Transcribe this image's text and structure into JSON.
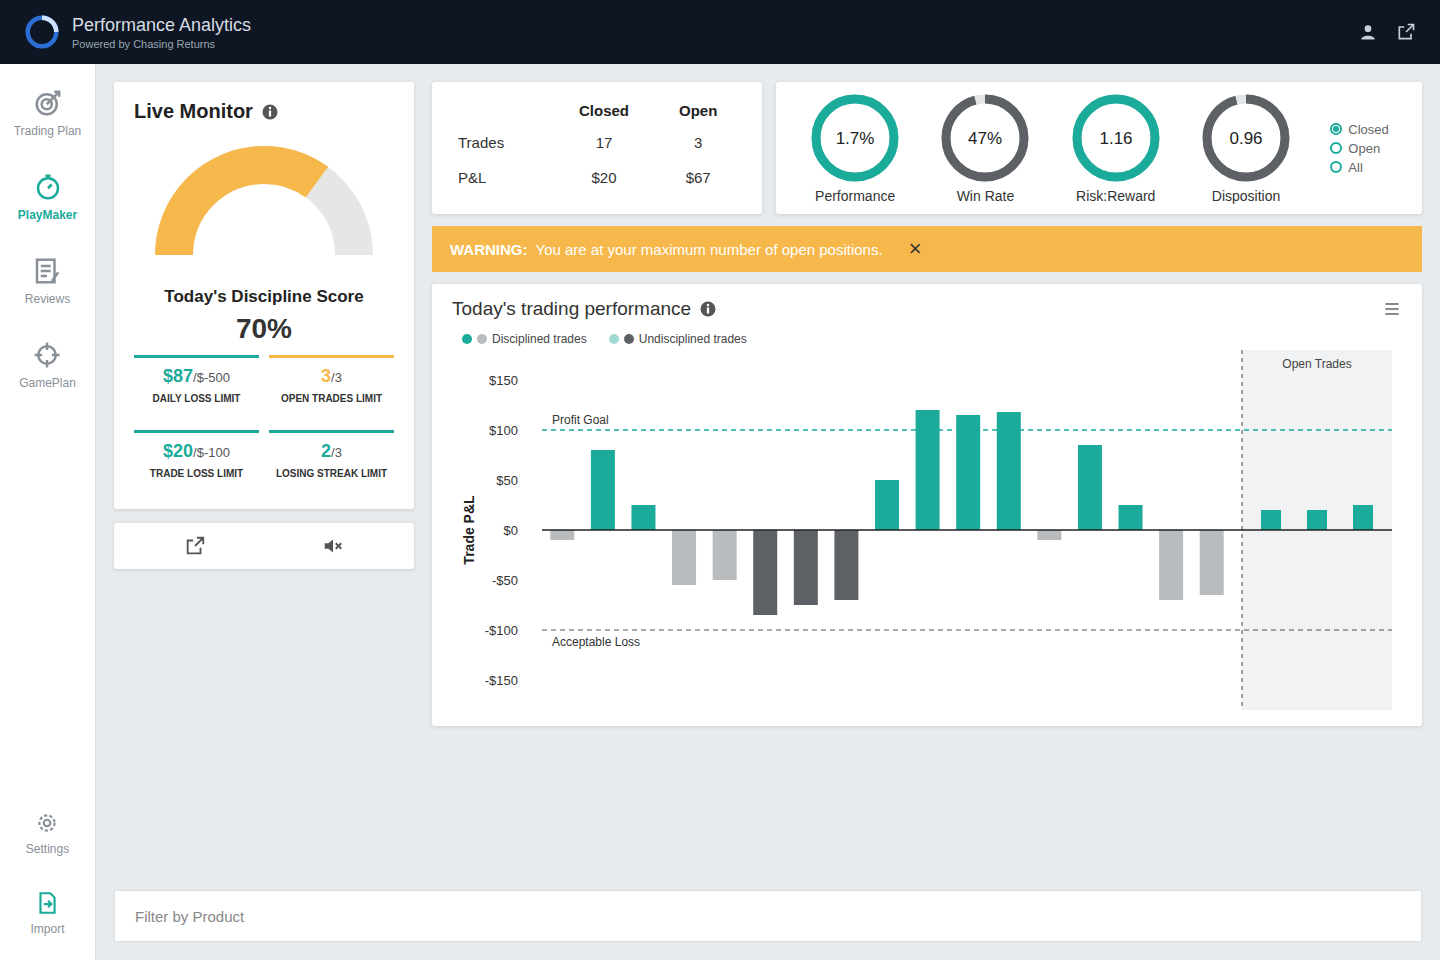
{
  "app": {
    "title": "Performance Analytics",
    "subtitle": "Powered by Chasing Returns"
  },
  "sidebar": {
    "items": [
      {
        "label": "Trading Plan",
        "selected": false
      },
      {
        "label": "PlayMaker",
        "selected": true
      },
      {
        "label": "Reviews",
        "selected": false
      },
      {
        "label": "GamePlan",
        "selected": false
      },
      {
        "label": "Settings",
        "selected": false
      },
      {
        "label": "Import",
        "selected": false
      }
    ]
  },
  "live_monitor": {
    "title": "Live Monitor",
    "score_label": "Today's Discipline Score",
    "score": "70%",
    "level": 0.7,
    "limits": [
      {
        "value": "$87",
        "limit": "/$-500",
        "label": "DAILY LOSS LIMIT",
        "color": "#1aab9b"
      },
      {
        "value": "3",
        "limit": "/3",
        "label": "OPEN TRADES LIMIT",
        "color": "#f7b84b"
      },
      {
        "value": "$20",
        "limit": "/$-100",
        "label": "TRADE LOSS LIMIT",
        "color": "#1aab9b"
      },
      {
        "value": "2",
        "limit": "/3",
        "label": "LOSING STREAK LIMIT",
        "color": "#1aab9b"
      }
    ]
  },
  "summary": {
    "columns": [
      "Closed",
      "Open"
    ],
    "rows": [
      {
        "label": "Trades",
        "cells": [
          "17",
          "3"
        ]
      },
      {
        "label": "P&L",
        "cells": [
          "$20",
          "$67"
        ]
      }
    ]
  },
  "gauges": [
    {
      "value": "1.7%",
      "label": "Performance",
      "level": 1,
      "color": "#1aab9b"
    },
    {
      "value": "47%",
      "label": "Win Rate",
      "level": 0.96,
      "color": "#5d6166"
    },
    {
      "value": "1.16",
      "label": "Risk:Reward",
      "level": 1,
      "color": "#1aab9b"
    },
    {
      "value": "0.96",
      "label": "Disposition",
      "level": 0.96,
      "color": "#5d6166"
    }
  ],
  "view_filter": {
    "options": [
      {
        "label": "Closed",
        "selected": true
      },
      {
        "label": "Open",
        "selected": false
      },
      {
        "label": "All",
        "selected": false
      }
    ]
  },
  "warning": {
    "label": "WARNING:",
    "text": "You are at your maximum number of open positions.",
    "close": "×"
  },
  "chart": {
    "title": "Today's trading performance",
    "axis_label": "Trade P&L",
    "ticks": [
      "$150",
      "$100",
      "$50",
      "$0",
      "-$50",
      "-$100",
      "-$150"
    ],
    "tick_values": [
      150,
      100,
      50,
      0,
      -50,
      -100,
      -150
    ],
    "legend": [
      {
        "label": "Disciplined trades",
        "colors": [
          "#1aab9b",
          "#b9bcbf"
        ]
      },
      {
        "label": "Undisciplined trades",
        "colors": [
          "#9fd9d2",
          "#5d6166"
        ]
      }
    ],
    "profit_goal": {
      "label": "Profit Goal",
      "value": 100
    },
    "acceptable_loss": {
      "label": "Acceptable Loss",
      "value": -100
    },
    "open_label": "Open Trades",
    "series": [
      {
        "name": "closed",
        "values": [
          -10,
          80,
          25,
          -55,
          -50,
          -85,
          -75,
          -70,
          50,
          120,
          115,
          118,
          -10,
          85,
          25,
          -70,
          -65
        ],
        "colors": [
          "#b9bcbf",
          "#1aab9b",
          "#1aab9b",
          "#b9bcbf",
          "#b9bcbf",
          "#5d6166",
          "#5d6166",
          "#5d6166",
          "#1aab9b",
          "#1aab9b",
          "#1aab9b",
          "#1aab9b",
          "#b9bcbf",
          "#1aab9b",
          "#1aab9b",
          "#b9bcbf",
          "#b9bcbf"
        ]
      },
      {
        "name": "open",
        "values": [
          20,
          20,
          25
        ],
        "colors": [
          "#1aab9b",
          "#1aab9b",
          "#1aab9b"
        ]
      }
    ]
  },
  "filter": {
    "placeholder": "Filter by Product"
  }
}
